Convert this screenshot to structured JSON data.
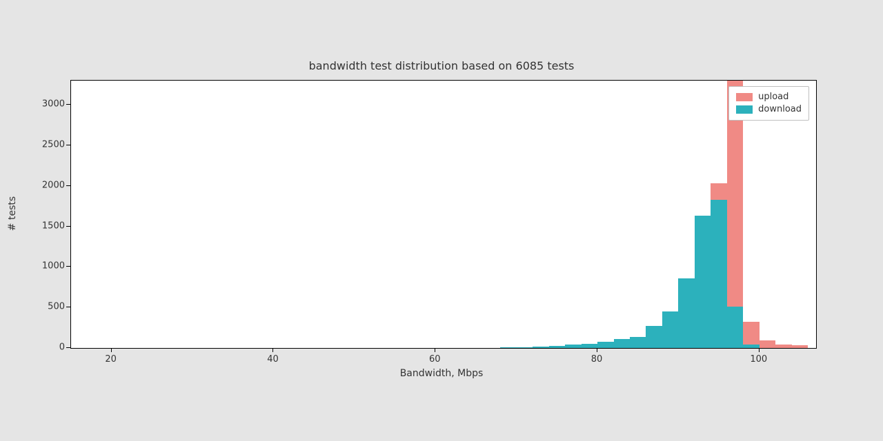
{
  "chart_data": {
    "type": "bar",
    "title": "bandwidth test distribution based on 6085 tests",
    "xlabel": "Bandwidth, Mbps",
    "ylabel": "# tests",
    "xlim": [
      15,
      107
    ],
    "ylim": [
      0,
      3300
    ],
    "x_ticks": [
      20,
      40,
      60,
      80,
      100
    ],
    "y_ticks": [
      0,
      500,
      1000,
      1500,
      2000,
      2500,
      3000
    ],
    "legend_position": "upper right",
    "histograms": {
      "bin_width": 2,
      "series": [
        {
          "name": "upload",
          "color": "#f08a85",
          "bins": [
            {
              "x0": 70,
              "x1": 72,
              "count": 5
            },
            {
              "x0": 72,
              "x1": 74,
              "count": 8
            },
            {
              "x0": 74,
              "x1": 76,
              "count": 10
            },
            {
              "x0": 76,
              "x1": 78,
              "count": 12
            },
            {
              "x0": 78,
              "x1": 80,
              "count": 15
            },
            {
              "x0": 80,
              "x1": 82,
              "count": 20
            },
            {
              "x0": 82,
              "x1": 84,
              "count": 25
            },
            {
              "x0": 84,
              "x1": 86,
              "count": 30
            },
            {
              "x0": 86,
              "x1": 88,
              "count": 40
            },
            {
              "x0": 88,
              "x1": 90,
              "count": 50
            },
            {
              "x0": 90,
              "x1": 92,
              "count": 70
            },
            {
              "x0": 92,
              "x1": 94,
              "count": 90
            },
            {
              "x0": 94,
              "x1": 96,
              "count": 2030
            },
            {
              "x0": 96,
              "x1": 98,
              "count": 3300
            },
            {
              "x0": 98,
              "x1": 100,
              "count": 320
            },
            {
              "x0": 100,
              "x1": 102,
              "count": 90
            },
            {
              "x0": 102,
              "x1": 104,
              "count": 45
            },
            {
              "x0": 104,
              "x1": 106,
              "count": 30
            }
          ]
        },
        {
          "name": "download",
          "color": "#2cb1bc",
          "bins": [
            {
              "x0": 68,
              "x1": 70,
              "count": 8
            },
            {
              "x0": 70,
              "x1": 72,
              "count": 12
            },
            {
              "x0": 72,
              "x1": 74,
              "count": 18
            },
            {
              "x0": 74,
              "x1": 76,
              "count": 25
            },
            {
              "x0": 76,
              "x1": 78,
              "count": 40
            },
            {
              "x0": 78,
              "x1": 80,
              "count": 55
            },
            {
              "x0": 80,
              "x1": 82,
              "count": 80
            },
            {
              "x0": 82,
              "x1": 84,
              "count": 110
            },
            {
              "x0": 84,
              "x1": 86,
              "count": 140
            },
            {
              "x0": 86,
              "x1": 88,
              "count": 270
            },
            {
              "x0": 88,
              "x1": 90,
              "count": 450
            },
            {
              "x0": 90,
              "x1": 92,
              "count": 860
            },
            {
              "x0": 92,
              "x1": 94,
              "count": 1630
            },
            {
              "x0": 94,
              "x1": 96,
              "count": 1830
            },
            {
              "x0": 96,
              "x1": 98,
              "count": 510
            },
            {
              "x0": 98,
              "x1": 100,
              "count": 40
            }
          ]
        }
      ]
    },
    "series": [
      {
        "name": "upload",
        "color": "#f08a85"
      },
      {
        "name": "download",
        "color": "#2cb1bc"
      }
    ]
  }
}
